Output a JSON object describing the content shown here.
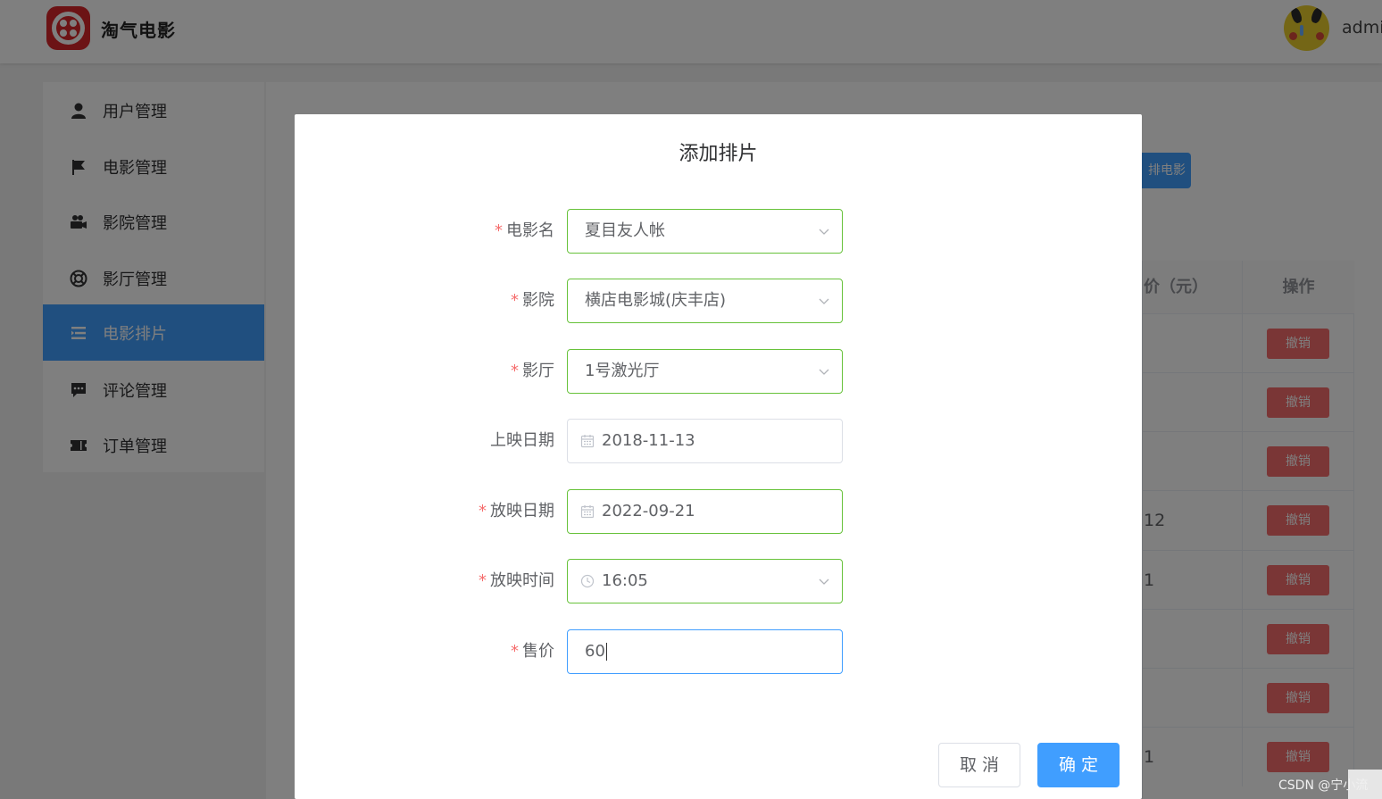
{
  "app": {
    "title": "淘气电影",
    "username": "admin"
  },
  "sidebar": {
    "items": [
      {
        "label": "用户管理",
        "icon": "user-icon"
      },
      {
        "label": "电影管理",
        "icon": "flag-icon"
      },
      {
        "label": "影院管理",
        "icon": "camera-icon"
      },
      {
        "label": "影厅管理",
        "icon": "lifebuoy-icon"
      },
      {
        "label": "电影排片",
        "icon": "list-icon",
        "active": true
      },
      {
        "label": "评论管理",
        "icon": "comment-icon"
      },
      {
        "label": "订单管理",
        "icon": "ticket-icon"
      }
    ]
  },
  "main": {
    "add_button_label": "排电影",
    "table": {
      "headers": [
        "价（元）",
        "操作"
      ],
      "rows": [
        {
          "price": "",
          "action": "撤销"
        },
        {
          "price": "",
          "action": "撤销"
        },
        {
          "price": "",
          "action": "撤销"
        },
        {
          "price": "12",
          "action": "撤销"
        },
        {
          "price": "1",
          "action": "撤销"
        },
        {
          "price": "",
          "action": "撤销"
        },
        {
          "price": "",
          "action": "撤销"
        },
        {
          "price": "1",
          "action": "撤销"
        }
      ]
    }
  },
  "dialog": {
    "title": "添加排片",
    "fields": {
      "movie": {
        "label": "电影名",
        "required": true,
        "value": "夏目友人帐"
      },
      "cinema": {
        "label": "影院",
        "required": true,
        "value": "横店电影城(庆丰店)"
      },
      "hall": {
        "label": "影厅",
        "required": true,
        "value": "1号激光厅"
      },
      "release_date": {
        "label": "上映日期",
        "required": false,
        "value": "2018-11-13"
      },
      "show_date": {
        "label": "放映日期",
        "required": true,
        "value": "2022-09-21"
      },
      "show_time": {
        "label": "放映时间",
        "required": true,
        "value": "16:05"
      },
      "price": {
        "label": "售价",
        "required": true,
        "value": "60"
      }
    },
    "cancel_label": "取 消",
    "confirm_label": "确 定"
  },
  "watermark": "CSDN @宁小流",
  "colors": {
    "primary": "#409eff",
    "danger": "#f56c6c",
    "success_border": "#67c23a",
    "brand_red": "#d8262a"
  }
}
